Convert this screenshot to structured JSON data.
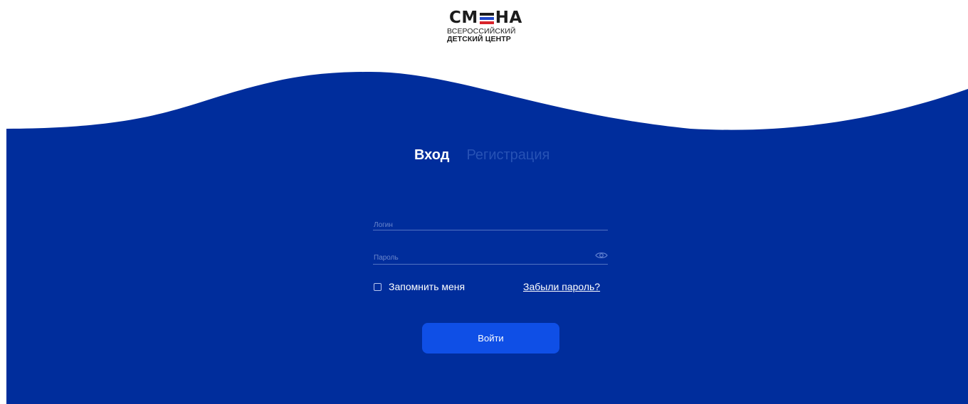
{
  "logo": {
    "wordmark_left": "CM",
    "wordmark_right": "HA",
    "line1": "ВСЕРОССИЙСКИЙ",
    "line2": "ДЕТСКИЙ ЦЕНТР"
  },
  "tabs": [
    {
      "label": "Вход",
      "active": true
    },
    {
      "label": "Регистрация",
      "active": false
    }
  ],
  "form": {
    "login": {
      "placeholder": "Логин",
      "value": ""
    },
    "password": {
      "placeholder": "Пароль",
      "value": "",
      "icon": "eye-icon"
    },
    "remember_label": "Запомнить меня",
    "remember_checked": false,
    "forgot_link": "Забыли пароль?",
    "submit_label": "Войти"
  },
  "colors": {
    "background": "#ffffff",
    "wave": "#002d9c",
    "button": "#0f4fe6",
    "inactive_tab": "#2752b5",
    "text_on_wave": "#ffffff"
  }
}
